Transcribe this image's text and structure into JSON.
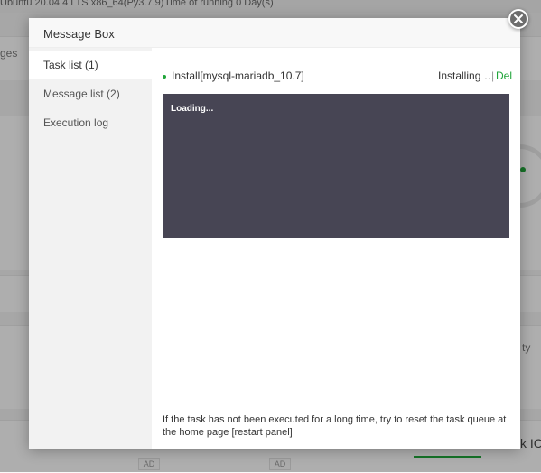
{
  "background": {
    "system_info": "Ubuntu 20.04.4 LTS x86_64(Py3.7.9)",
    "running_time": "Time of running 0 Day(s)",
    "left_fragment": "ges",
    "right_fragment": "ty",
    "right_fragment_2": "k IC",
    "ad_label": "AD"
  },
  "modal": {
    "title": "Message Box",
    "close_icon": "close-icon"
  },
  "sidebar": {
    "items": [
      {
        "label": "Task list (1)",
        "active": true
      },
      {
        "label": "Message list (2)",
        "active": false
      },
      {
        "label": "Execution log",
        "active": false
      }
    ]
  },
  "task": {
    "name": "Install[mysql-mariadb_10.7]",
    "status": "Installing …",
    "separator": "|",
    "delete_label": "Del"
  },
  "console": {
    "text": "Loading..."
  },
  "hint": "If the task has not been executed for a long time, try to reset the task queue at the home page [restart panel]",
  "colors": {
    "accent": "#20a53a",
    "console_bg": "#474554",
    "sidebar_bg": "#f2f2f2"
  }
}
